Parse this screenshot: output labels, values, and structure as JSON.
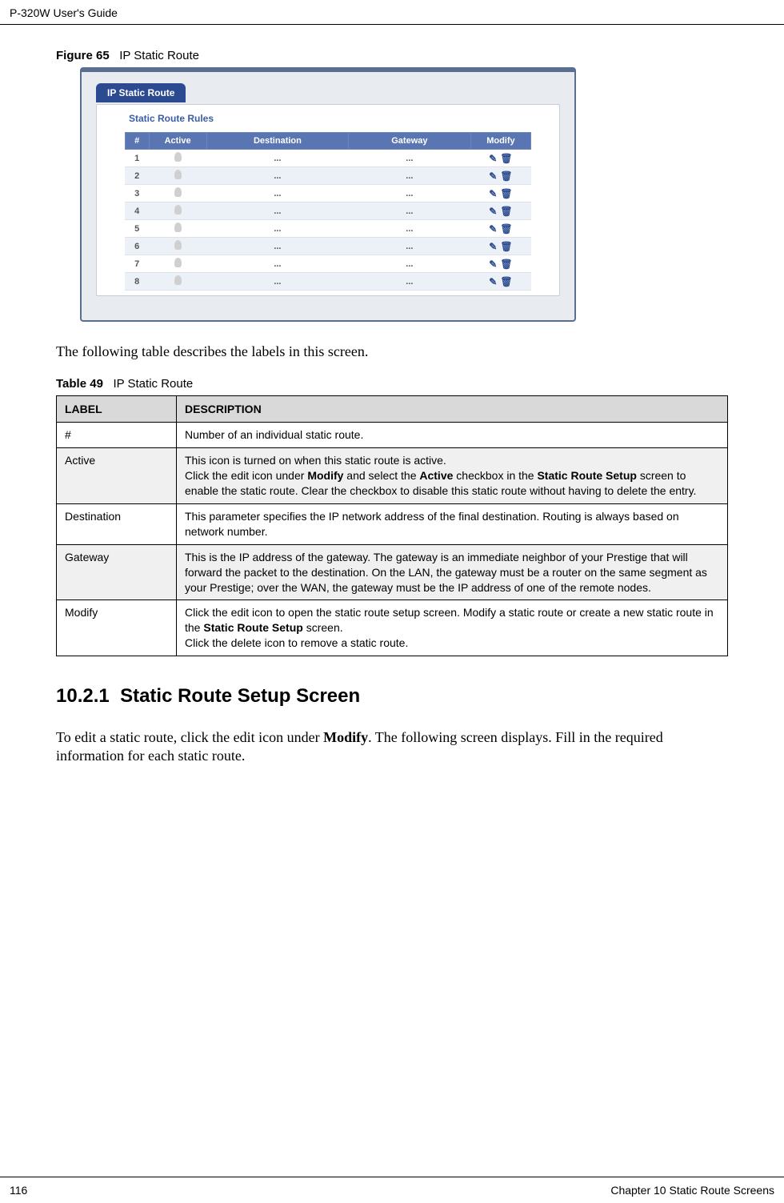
{
  "header": {
    "left": "P-320W User's Guide"
  },
  "figure": {
    "label": "Figure 65",
    "title": "IP Static Route"
  },
  "screenshot": {
    "tab_label": "IP Static Route",
    "panel_title": "Static Route Rules",
    "cols": {
      "num": "#",
      "active": "Active",
      "dest": "Destination",
      "gateway": "Gateway",
      "modify": "Modify"
    },
    "rows": [
      {
        "n": "1",
        "dest": "...",
        "gw": "..."
      },
      {
        "n": "2",
        "dest": "...",
        "gw": "..."
      },
      {
        "n": "3",
        "dest": "...",
        "gw": "..."
      },
      {
        "n": "4",
        "dest": "...",
        "gw": "..."
      },
      {
        "n": "5",
        "dest": "...",
        "gw": "..."
      },
      {
        "n": "6",
        "dest": "...",
        "gw": "..."
      },
      {
        "n": "7",
        "dest": "...",
        "gw": "..."
      },
      {
        "n": "8",
        "dest": "...",
        "gw": "..."
      }
    ]
  },
  "intro_text": "The following table describes the labels in this screen.",
  "table": {
    "label": "Table 49",
    "title": "IP Static Route",
    "head": {
      "label": "LABEL",
      "desc": "DESCRIPTION"
    },
    "rows": {
      "num": {
        "label": "#",
        "desc": "Number of an individual static route."
      },
      "active": {
        "label": "Active",
        "desc_line1": "This icon is turned on when this static route is active.",
        "desc_line2a": "Click the edit icon under ",
        "desc_line2b": " and select the ",
        "desc_line2c": " checkbox in the ",
        "desc_line2d": " screen to enable the static route. Clear the checkbox to disable this static route without having to delete the entry.",
        "bold_modify": "Modify",
        "bold_active": "Active",
        "bold_srs": "Static Route Setup"
      },
      "dest": {
        "label": "Destination",
        "desc": "This parameter specifies the IP network address of the final destination. Routing is always based on network number."
      },
      "gateway": {
        "label": "Gateway",
        "desc": "This is the IP address of the gateway. The gateway is an immediate neighbor of your Prestige that will forward the packet to the destination. On the LAN, the gateway must be a router on the same segment as your Prestige; over the WAN, the gateway must be the IP address of one of the remote nodes."
      },
      "modify": {
        "label": "Modify",
        "desc_line1a": "Click the edit icon to open the static route setup screen. Modify a static route or create a new static route in the ",
        "desc_line1b": " screen.",
        "bold_srs": "Static Route Setup",
        "desc_line2": "Click the delete icon to remove a static route."
      }
    }
  },
  "section": {
    "number": "10.2.1",
    "title": "Static Route Setup Screen",
    "para_a": "To edit a static route, click the edit icon under ",
    "para_bold": "Modify",
    "para_b": ". The following screen displays. Fill in the required information for each static route."
  },
  "footer": {
    "left": "116",
    "right": "Chapter 10 Static Route Screens"
  }
}
